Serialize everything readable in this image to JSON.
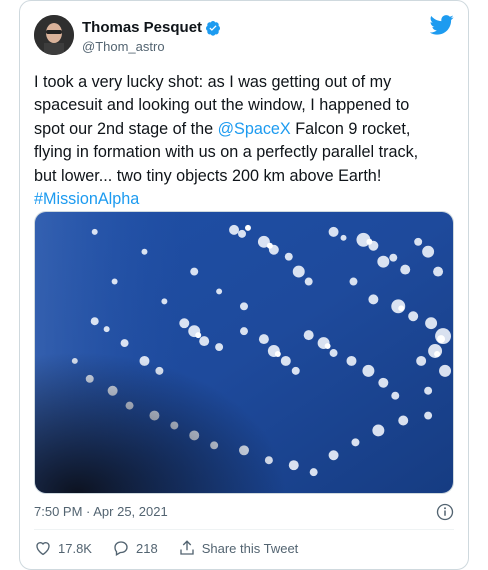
{
  "author": {
    "name": "Thomas Pesquet",
    "handle": "@Thom_astro",
    "avatar_icon": "astronaut-avatar",
    "verified_icon": "verified-badge-icon"
  },
  "brand": {
    "logo_icon": "twitter-bird-icon",
    "accent": "#1d9bf0"
  },
  "tweet": {
    "text_part1": "I took a very lucky shot: as I was getting out of my spacesuit and looking out the window, I happened to spot our 2nd stage of the ",
    "mention": "@SpaceX",
    "text_part2": " Falcon 9 rocket, flying in formation with us on a perfectly parallel track, but lower... two tiny objects 200 km above Earth!",
    "hashtag": "#MissionAlpha",
    "timestamp": "7:50 PM · Apr 25, 2021"
  },
  "actions": {
    "likes": "17.8K",
    "replies": "218",
    "share_label": "Share this Tweet"
  },
  "icons": {
    "info": "info-icon",
    "like": "heart-icon",
    "reply": "reply-icon",
    "share": "share-icon"
  }
}
